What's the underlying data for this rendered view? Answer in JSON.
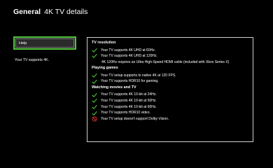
{
  "header": {
    "title": "General",
    "subtitle": "4K TV details"
  },
  "help": {
    "label": "Help"
  },
  "summary": "Your TV supports 4K.",
  "colors": {
    "accent": "#4fc33b",
    "error": "#e0312b",
    "panel_border": "#cfcfcf"
  },
  "sections": [
    {
      "title": "TV resolution",
      "items": [
        {
          "icon": "check-icon",
          "text": "Your TV supports 4K UHD at 60Hz."
        },
        {
          "icon": "check-icon",
          "text": "Your TV supports 4K UHD at 120Hz."
        },
        {
          "icon": "none",
          "text": "4K 120Hz requires an Ultra High-Speed HDMI cable (included with Xbox Series X)"
        }
      ]
    },
    {
      "title": "Playing games",
      "items": [
        {
          "icon": "check-icon",
          "text": "Your TV setup supports to native 4K at 120 FPS."
        },
        {
          "icon": "check-icon",
          "text": "Your TV supports HDR10 for gaming."
        }
      ]
    },
    {
      "title": "Watching movies and TV",
      "items": [
        {
          "icon": "check-icon",
          "text": "Your TV supports 4K 10-bit at 24Hz."
        },
        {
          "icon": "check-icon",
          "text": "Your TV supports 4K 10-bit at 50Hz."
        },
        {
          "icon": "check-icon",
          "text": "Your TV supports 4K 10-bit at 60Hz."
        },
        {
          "icon": "check-icon",
          "text": "Your TV supports HDR10 video."
        },
        {
          "icon": "blocked-icon",
          "text": "Your TV setup doesn't support Dolby Vision."
        }
      ]
    }
  ]
}
